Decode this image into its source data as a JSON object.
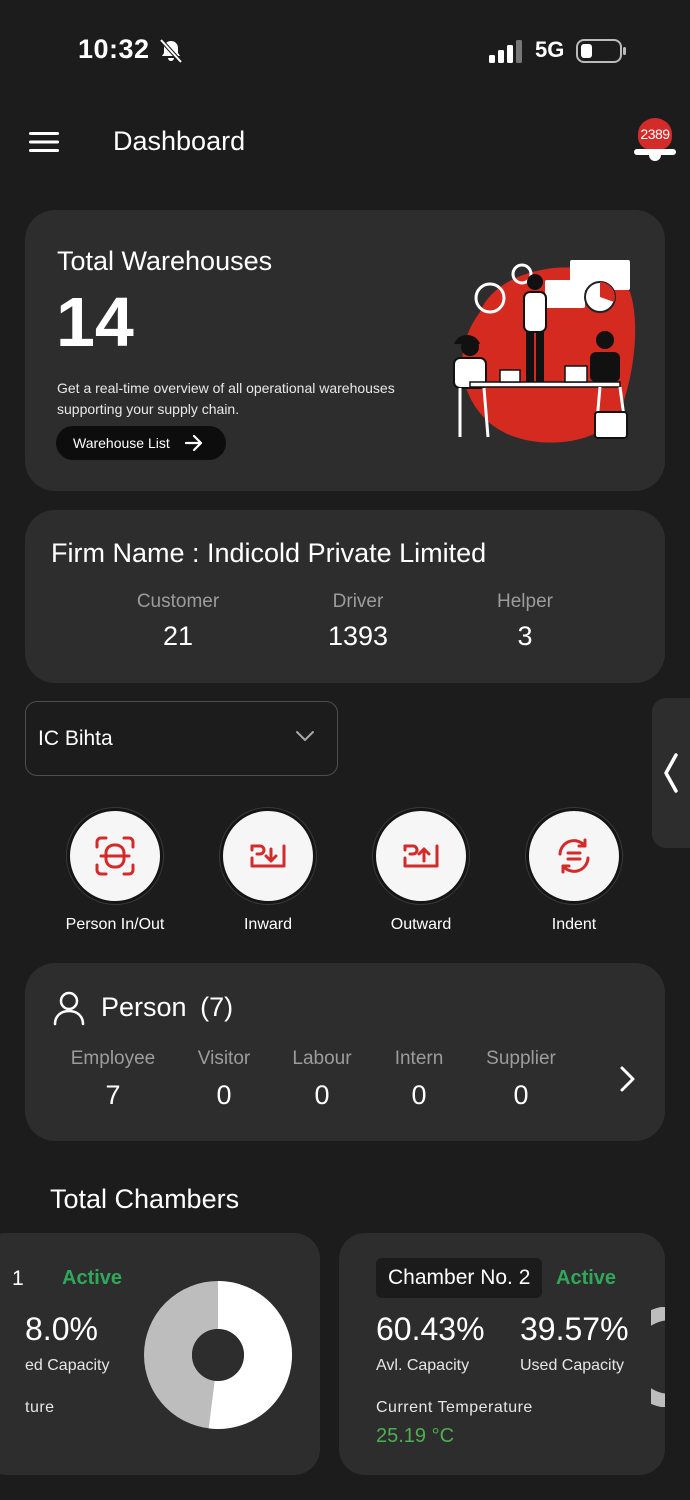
{
  "status_bar": {
    "time": "10:32",
    "network": "5G"
  },
  "header": {
    "title": "Dashboard",
    "notification_count": "2389"
  },
  "warehouses": {
    "label": "Total Warehouses",
    "count": "14",
    "description": "Get a real-time overview of all operational warehouses supporting your supply chain.",
    "button_label": "Warehouse List"
  },
  "firm": {
    "title": "Firm Name : Indicold Private Limited",
    "stats": [
      {
        "label": "Customer",
        "value": "21"
      },
      {
        "label": "Driver",
        "value": "1393"
      },
      {
        "label": "Helper",
        "value": "3"
      }
    ]
  },
  "warehouse_select": {
    "value": "IC Bihta"
  },
  "actions": [
    {
      "label": "Person In/Out",
      "icon": "scan-person-icon"
    },
    {
      "label": "Inward",
      "icon": "inward-icon"
    },
    {
      "label": "Outward",
      "icon": "outward-icon"
    },
    {
      "label": "Indent",
      "icon": "indent-exchange-icon"
    }
  ],
  "person": {
    "title": "Person",
    "count": "(7)",
    "stats": [
      {
        "label": "Employee",
        "value": "7"
      },
      {
        "label": "Visitor",
        "value": "0"
      },
      {
        "label": "Labour",
        "value": "0"
      },
      {
        "label": "Intern",
        "value": "0"
      },
      {
        "label": "Supplier",
        "value": "0"
      }
    ]
  },
  "chambers": {
    "title": "Total Chambers",
    "cards": [
      {
        "name": "1",
        "status": "Active",
        "used_pct": "8.0%",
        "used_label": "ed Capacity",
        "temp_label": "ture",
        "used_fraction": 0.52
      },
      {
        "name": "Chamber No. 2",
        "status": "Active",
        "avl_pct": "60.43%",
        "avl_label": "Avl. Capacity",
        "used_pct": "39.57%",
        "used_label": "Used Capacity",
        "temp_label": "Current Temperature",
        "temp_value": "25.19 °C"
      }
    ]
  },
  "colors": {
    "accent_red": "#d32a2a",
    "active_green": "#2fa85a",
    "card_bg": "#2d2d2d",
    "page_bg": "#1c1c1c"
  }
}
